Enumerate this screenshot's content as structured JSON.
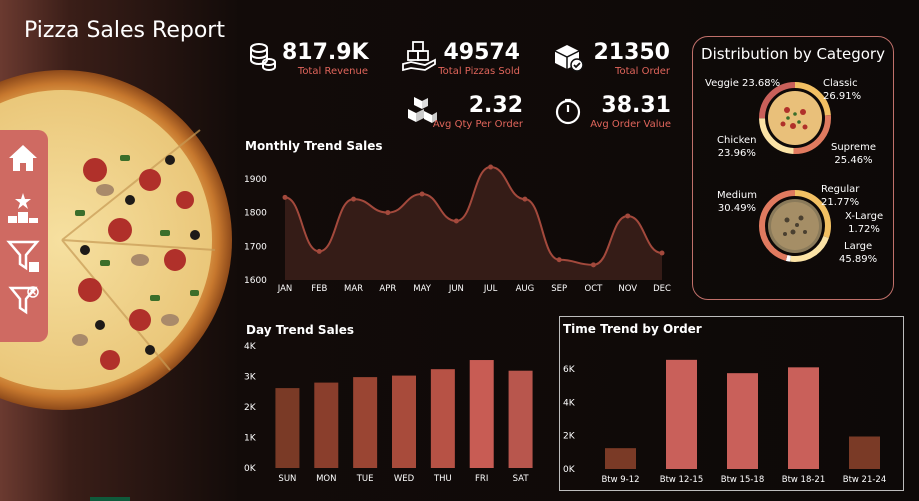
{
  "report": {
    "title": "Pizza Sales Report"
  },
  "sidebar": {
    "items": [
      {
        "icon": "home-icon"
      },
      {
        "icon": "ranking-icon"
      },
      {
        "icon": "filter-icon"
      },
      {
        "icon": "clear-filter-icon"
      }
    ]
  },
  "kpis": [
    {
      "value": "817.9K",
      "label": "Total Revenue",
      "icon": "coins-icon"
    },
    {
      "value": "49574",
      "label": "Total Pizzas Sold",
      "icon": "hand-boxes-icon"
    },
    {
      "value": "21350",
      "label": "Total Order",
      "icon": "package-check-icon"
    },
    {
      "value": "2.32",
      "label": "Avg Qty Per Order",
      "icon": "boxes-icon"
    },
    {
      "value": "38.31",
      "label": "Avg Order Value",
      "icon": "speedometer-icon"
    }
  ],
  "colors": {
    "accent": "#cf6a62",
    "bar_dark": "#7a3a26",
    "bar_light": "#c9605a",
    "line": "#a3493c",
    "label_red": "#e0655b"
  },
  "distribution": {
    "title": "Distribution by Category",
    "category": [
      {
        "name": "Veggie",
        "value": "23.68%"
      },
      {
        "name": "Classic",
        "value": "26.91%"
      },
      {
        "name": "Chicken",
        "value": "23.96%"
      },
      {
        "name": "Supreme",
        "value": "25.46%"
      }
    ],
    "size": [
      {
        "name": "Medium",
        "value": "30.49%"
      },
      {
        "name": "Regular",
        "value": "21.77%"
      },
      {
        "name": "X-Large",
        "value": "1.72%"
      },
      {
        "name": "Large",
        "value": "45.89%"
      }
    ]
  },
  "chart_data": [
    {
      "type": "area",
      "title": "Monthly Trend Sales",
      "categories": [
        "JAN",
        "FEB",
        "MAR",
        "APR",
        "MAY",
        "JUN",
        "JUL",
        "AUG",
        "SEP",
        "OCT",
        "NOV",
        "DEC"
      ],
      "values": [
        1845,
        1685,
        1840,
        1800,
        1855,
        1775,
        1935,
        1840,
        1660,
        1645,
        1790,
        1680
      ],
      "yticks": [
        "1600",
        "1700",
        "1800",
        "1900"
      ],
      "ylim": [
        1600,
        1950
      ],
      "grid": false
    },
    {
      "type": "bar",
      "title": "Day Trend Sales",
      "categories": [
        "SUN",
        "MON",
        "TUE",
        "WED",
        "THU",
        "FRI",
        "SAT"
      ],
      "values": [
        2620,
        2800,
        2980,
        3030,
        3240,
        3540,
        3190
      ],
      "yticks": [
        "0K",
        "1K",
        "2K",
        "3K",
        "4K"
      ],
      "ylim": [
        0,
        4000
      ],
      "grid": false
    },
    {
      "type": "bar",
      "title": "Time Trend by Order",
      "categories": [
        "Btw 9-12",
        "Btw 12-15",
        "Btw 15-18",
        "Btw 18-21",
        "Btw 21-24"
      ],
      "values": [
        1250,
        6550,
        5750,
        6100,
        1950
      ],
      "yticks": [
        "0K",
        "2K",
        "4K",
        "6K"
      ],
      "ylim": [
        0,
        7200
      ],
      "grid": false
    }
  ]
}
